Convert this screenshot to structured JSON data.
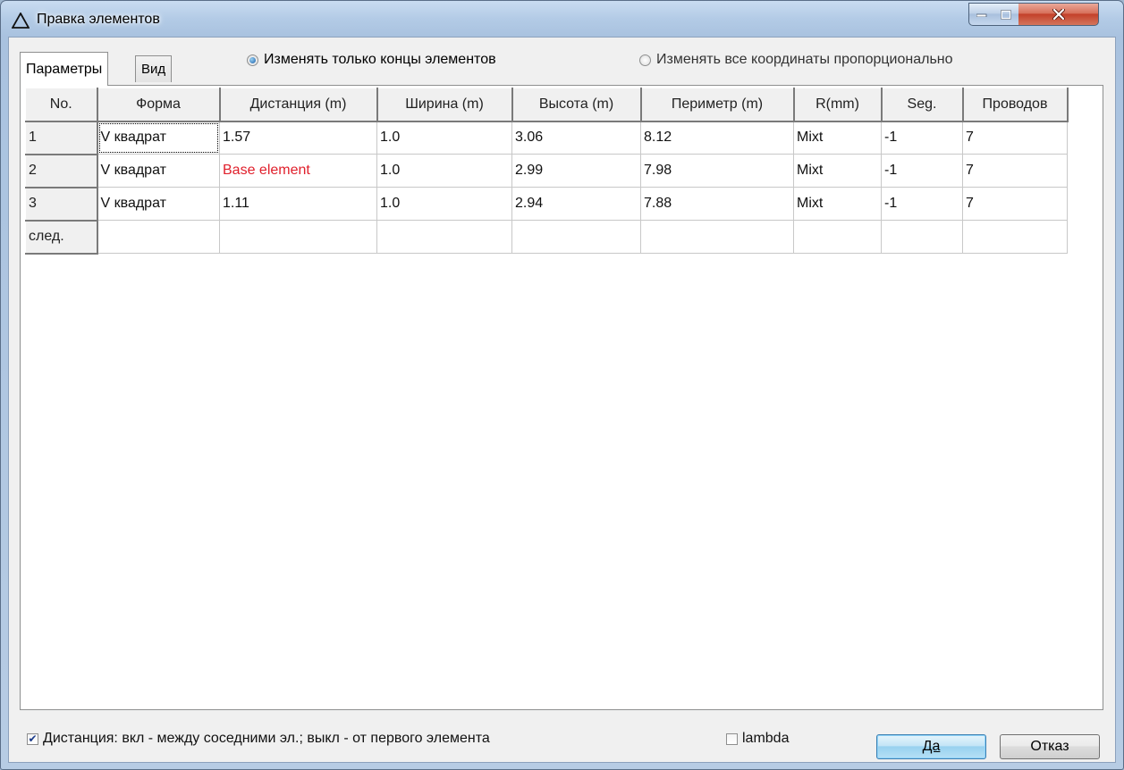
{
  "window": {
    "title": "Правка элементов"
  },
  "tabs": [
    {
      "label": "Параметры",
      "active": true
    },
    {
      "label": "Вид",
      "active": false
    }
  ],
  "mode_options": [
    {
      "label": "Изменять только концы элементов",
      "selected": true
    },
    {
      "label": "Изменять все координаты пропорционально",
      "selected": false
    }
  ],
  "table": {
    "columns": [
      "No.",
      "Форма",
      "Дистанция (m)",
      "Ширина (m)",
      "Высота (m)",
      "Периметр (m)",
      "R(mm)",
      "Seg.",
      "Проводов"
    ],
    "rows": [
      {
        "no": "1",
        "shape": "V квадрат",
        "distance": "1.57",
        "width": "1.0",
        "height": "3.06",
        "perimeter": "8.12",
        "r": "Mixt",
        "seg": "-1",
        "wires": "7"
      },
      {
        "no": "2",
        "shape": "V квадрат",
        "distance": "Base element",
        "width": "1.0",
        "height": "2.99",
        "perimeter": "7.98",
        "r": "Mixt",
        "seg": "-1",
        "wires": "7"
      },
      {
        "no": "3",
        "shape": "V квадрат",
        "distance": "1.11",
        "width": "1.0",
        "height": "2.94",
        "perimeter": "7.88",
        "r": "Mixt",
        "seg": "-1",
        "wires": "7"
      },
      {
        "no": "след.",
        "shape": "",
        "distance": "",
        "width": "",
        "height": "",
        "perimeter": "",
        "r": "",
        "seg": "",
        "wires": ""
      }
    ]
  },
  "options": {
    "distance_mode": {
      "label": "Дистанция: вкл - между соседними эл.; выкл - от первого элемента",
      "checked": true
    },
    "lambda": {
      "label": "lambda",
      "checked": false
    }
  },
  "buttons": {
    "ok": "Да",
    "cancel": "Отказ"
  },
  "colors": {
    "base_element_text": "#e0202c",
    "radio_selected": "#1a5ea8"
  }
}
